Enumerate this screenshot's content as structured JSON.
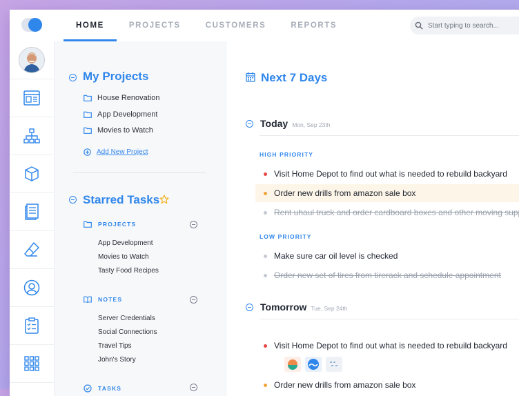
{
  "colors": {
    "accent": "#2f86eb",
    "high_dot": "#e64545",
    "medium_dot": "#f2a43a",
    "low_dot": "#c4c9d2",
    "highlight": "#fdf6e8"
  },
  "topbar": {
    "tabs": [
      {
        "label": "HOME",
        "active": true
      },
      {
        "label": "PROJECTS",
        "active": false
      },
      {
        "label": "CUSTOMERS",
        "active": false
      },
      {
        "label": "REPORTS",
        "active": false
      }
    ],
    "search": {
      "placeholder": "Start typing to search..."
    }
  },
  "rail": {
    "icons": [
      "avatar",
      "dashboard-icon",
      "sitemap-icon",
      "box-icon",
      "document-icon",
      "eraser-icon",
      "user-circle-icon",
      "clipboard-icon",
      "grid-icon"
    ]
  },
  "sidebar": {
    "my_projects": {
      "title": "My Projects",
      "items": [
        "House Renovation",
        "App Development",
        "Movies to Watch"
      ],
      "add_label": "Add New Project"
    },
    "starred": {
      "title": "Starred Tasks",
      "groups": [
        {
          "label": "PROJECTS",
          "items": [
            "App Development",
            "Movies to Watch",
            "Tasty Food Recipes"
          ]
        },
        {
          "label": "NOTES",
          "items": [
            "Server Credentials",
            "Social Connections",
            "Travel Tips",
            "John's Story"
          ]
        },
        {
          "label": "TASKS",
          "items": []
        }
      ]
    }
  },
  "main": {
    "title": "Next 7 Days",
    "days": [
      {
        "name": "Today",
        "date": "Mon, Sep 23th",
        "high_label": "HIGH PRIORITY",
        "high": [
          {
            "text": "Visit Home Depot to find out what is needed to rebuild backyard",
            "dot": "high",
            "done": false,
            "highlight": false
          },
          {
            "text": "Order new drills from amazon sale box",
            "dot": "medium",
            "done": false,
            "highlight": true
          },
          {
            "text": "Rent uhaul truck and order cardboard boxes and other moving supplies",
            "dot": "low",
            "done": true,
            "highlight": false
          }
        ],
        "low_label": "LOW PRIORITY",
        "low": [
          {
            "text": "Make sure car oil level is checked",
            "dot": "low",
            "done": false,
            "highlight": false
          },
          {
            "text": "Order new set of tires from tirerack and schedule appointment",
            "dot": "low",
            "done": true,
            "highlight": false
          }
        ]
      },
      {
        "name": "Tomorrow",
        "date": "Tue, Sep 24th",
        "tasks": [
          {
            "text": "Visit Home Depot to find out what is needed to rebuild backyard",
            "dot": "high"
          },
          {
            "text": "Order new drills from amazon sale box",
            "dot": "medium"
          }
        ]
      }
    ]
  }
}
